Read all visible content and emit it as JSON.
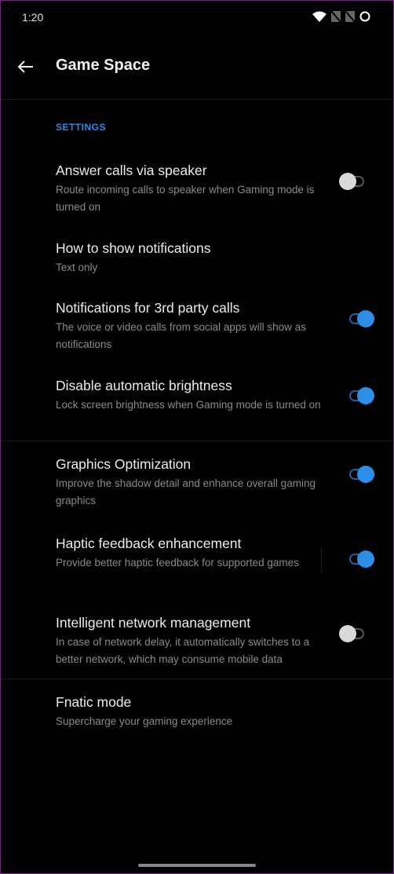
{
  "status_bar": {
    "time": "1:20",
    "icons": [
      "wifi-icon",
      "no-sim-icon",
      "no-sim-icon",
      "sync-ring-icon"
    ]
  },
  "app_bar": {
    "title": "Game Space",
    "back_icon": "arrow-left-icon"
  },
  "section_header": "SETTINGS",
  "settings": [
    {
      "title": "Answer calls via speaker",
      "subtitle": "Route incoming calls to speaker when Gaming mode is turned on",
      "toggle": false
    },
    {
      "title": "How to show notifications",
      "subtitle": "Text only",
      "toggle": null
    },
    {
      "title": "Notifications for 3rd party calls",
      "subtitle": "The voice or video calls from social apps will show as notifications",
      "toggle": true
    },
    {
      "title": "Disable automatic brightness",
      "subtitle": "Lock screen brightness when Gaming mode is turned on",
      "toggle": true
    },
    {
      "title": "Graphics Optimization",
      "subtitle": "Improve the shadow detail and enhance overall gaming graphics",
      "toggle": true
    },
    {
      "title": "Haptic feedback enhancement",
      "subtitle": "Provide better haptic feedback for supported games",
      "toggle": true
    },
    {
      "title": "Intelligent network management",
      "subtitle": "In case of network delay, it automatically switches to a better network, which may consume mobile data",
      "toggle": false
    },
    {
      "title": "Fnatic mode",
      "subtitle": "Supercharge your gaming experience",
      "toggle": null
    }
  ],
  "colors": {
    "accent": "#2d8ee8",
    "background": "#000000"
  }
}
